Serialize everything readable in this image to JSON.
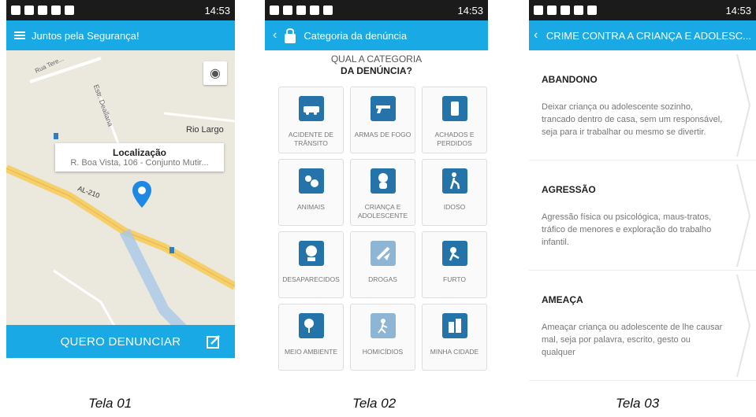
{
  "status_bar": {
    "time": "14:53"
  },
  "tela01": {
    "appbar_title": "Juntos pela Segurança!",
    "map": {
      "place_label": "Rio Largo",
      "road_label_1": "AL-210",
      "road_label_2": "Estr. Deallana",
      "road_label_3": "Rua Tere..."
    },
    "info": {
      "title": "Localização",
      "address": "R. Boa Vista, 106 - Conjunto Mutir..."
    },
    "cta": "QUERO DENUNCIAR",
    "caption": "Tela 01"
  },
  "tela02": {
    "appbar_title": "Categoria da denúncia",
    "question_line1": "QUAL A CATEGORIA",
    "question_line2": "DA DENÚNCIA?",
    "categories": [
      {
        "label": "ACIDENTE DE TRÂNSITO",
        "icon": "car-icon"
      },
      {
        "label": "ARMAS DE FOGO",
        "icon": "gun-icon"
      },
      {
        "label": "ACHADOS E PERDIDOS",
        "icon": "phone-found-icon"
      },
      {
        "label": "ANIMAIS",
        "icon": "animals-icon"
      },
      {
        "label": "CRIANÇA E ADOLESCENTE",
        "icon": "child-icon"
      },
      {
        "label": "IDOSO",
        "icon": "elderly-icon"
      },
      {
        "label": "DESAPARECIDOS",
        "icon": "missing-icon"
      },
      {
        "label": "DROGAS",
        "icon": "drugs-icon"
      },
      {
        "label": "FURTO",
        "icon": "theft-icon"
      },
      {
        "label": "MEIO AMBIENTE",
        "icon": "environment-icon"
      },
      {
        "label": "HOMICÍDIOS",
        "icon": "homicide-icon"
      },
      {
        "label": "MINHA CIDADE",
        "icon": "city-icon"
      }
    ],
    "caption": "Tela 02"
  },
  "tela03": {
    "appbar_title": "CRIME CONTRA A CRIANÇA E ADOLESC...",
    "items": [
      {
        "title": "ABANDONO",
        "desc": "Deixar criança ou adolescente sozinho, trancado dentro de casa, sem um responsável, seja para ir trabalhar ou mesmo se divertir."
      },
      {
        "title": "AGRESSÃO",
        "desc": "Agressão física ou psicológica, maus-tratos, tráfico de menores e exploração do trabalho infantil."
      },
      {
        "title": "AMEAÇA",
        "desc": "Ameaçar criança ou adolescente de lhe causar mal, seja por palavra, escrito, gesto ou qualquer"
      }
    ],
    "caption": "Tela 03"
  },
  "colors": {
    "primary": "#19a9e5",
    "icon_blue": "#2574a9",
    "status_bar": "#1b1b1b"
  }
}
